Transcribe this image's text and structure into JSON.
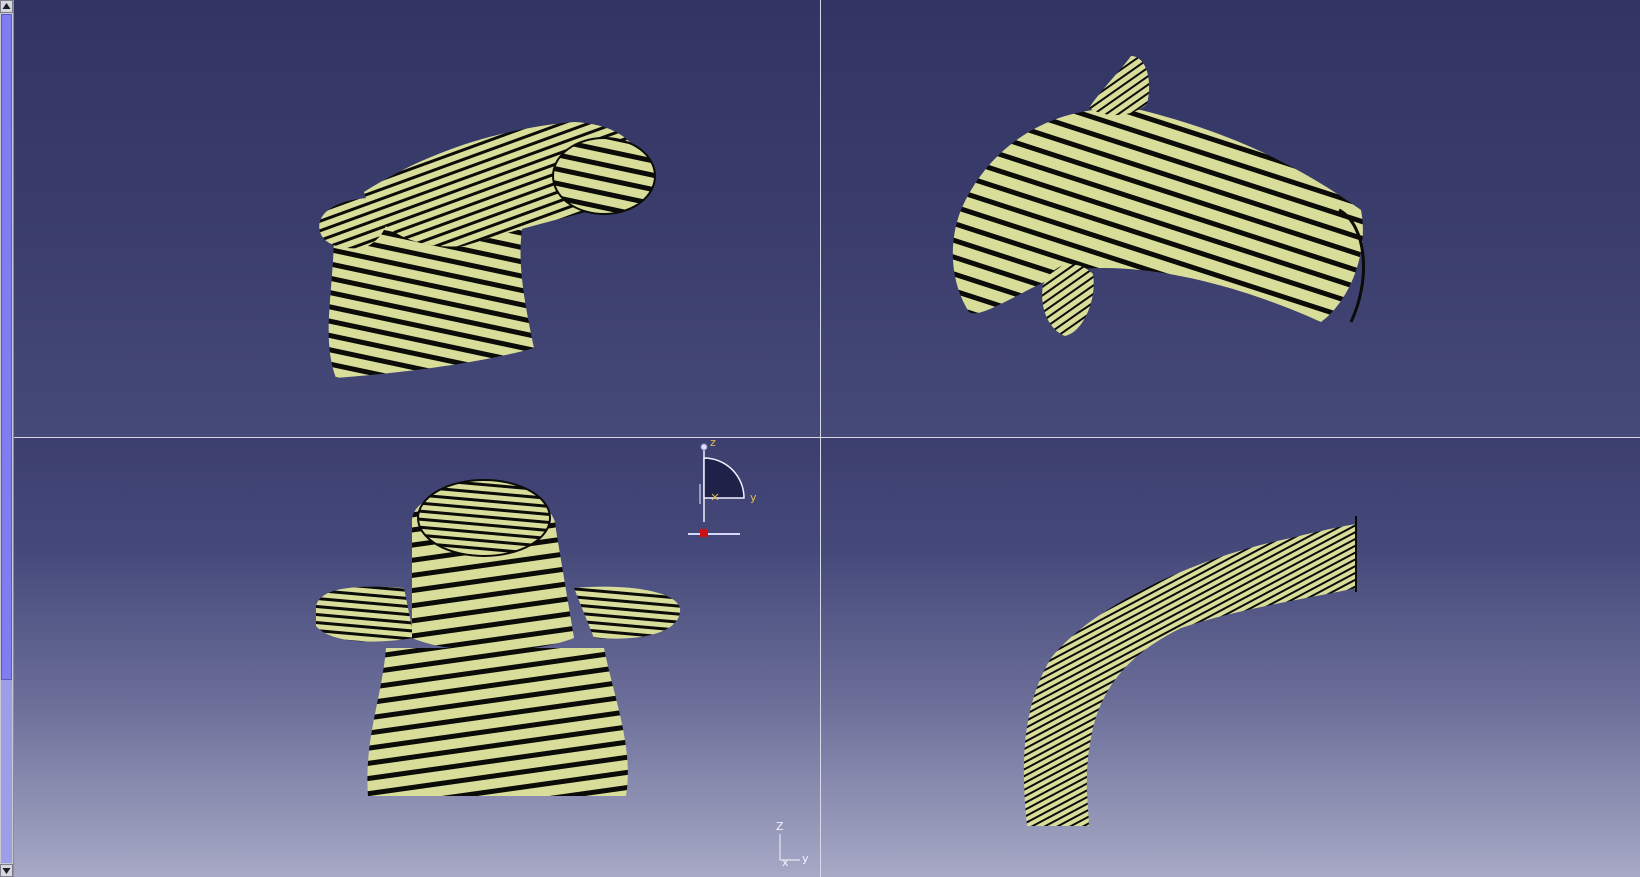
{
  "app": {
    "colors": {
      "background_top": "#323464",
      "background_bottom": "#a7a9c6",
      "part_fill": "#d9dd9a",
      "part_stripe": "#0b0b08",
      "split_line": "#d8d8e8",
      "scroll_thumb": "#7e7ef2"
    }
  },
  "scrollbar": {
    "up_icon": "arrow-up-icon",
    "down_icon": "arrow-down-icon"
  },
  "viewports": {
    "top_left": {
      "description_icon": "part-isometric-view"
    },
    "top_right": {
      "description_icon": "part-side-view"
    },
    "bottom_left": {
      "description_icon": "part-front-view"
    },
    "bottom_right": {
      "description_icon": "part-top-view"
    }
  },
  "compass": {
    "z_label": "z",
    "y_label": "y",
    "x_label": "x"
  },
  "axis_glyph": {
    "z_label": "Z",
    "y_label": "y",
    "x_label": "x"
  }
}
